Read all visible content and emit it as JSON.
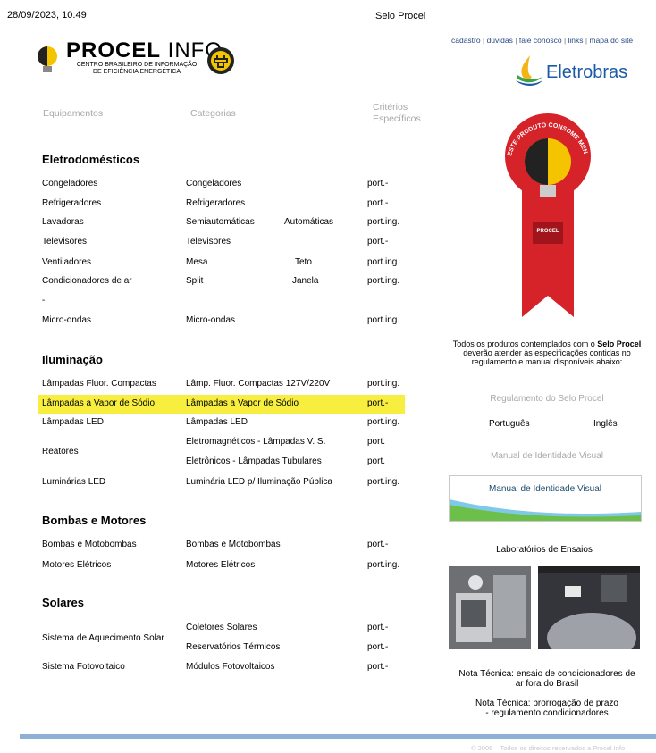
{
  "header": {
    "date": "28/09/2023, 10:49",
    "page_title": "Selo Procel"
  },
  "logo": {
    "name_bold": "PROCEL",
    "name_light": " INFO",
    "subtitle_line1": "CENTRO BRASILEIRO DE INFORMAÇÃO",
    "subtitle_line2": "DE EFICIÊNCIA ENERGÉTICA"
  },
  "top_links": [
    "cadastro",
    "dúvidas",
    "fale conosco",
    "links",
    "mapa do site"
  ],
  "eletrobras": "Eletrobras",
  "columns": {
    "equipamentos": "Equipamentos",
    "categorias": "Categorias",
    "criterios_1": "Critérios",
    "criterios_2": "Específicos"
  },
  "sections": {
    "eletrodomesticos": "Eletrodomésticos",
    "iluminacao": "Iluminação",
    "bombas": "Bombas e Motores",
    "solares": "Solares"
  },
  "rows": {
    "congeladores": {
      "equip": "Congeladores",
      "cat": "Congeladores",
      "crit": "port.-"
    },
    "refrigeradores": {
      "equip": "Refrigeradores",
      "cat": "Refrigeradores",
      "crit": "port.-"
    },
    "lavadoras": {
      "equip": "Lavadoras",
      "cat": "Semiautomáticas",
      "cat2": "Automáticas",
      "crit": "port.ing."
    },
    "televisores": {
      "equip": "Televisores",
      "cat": "Televisores",
      "crit": "port.-"
    },
    "ventiladores": {
      "equip": "Ventiladores",
      "cat": "Mesa",
      "cat2": "Teto",
      "crit": "port.ing."
    },
    "condicionadores": {
      "equip": "Condicionadores de ar",
      "cat": "Split",
      "cat2": "Janela",
      "crit": "port.ing."
    },
    "dash": "-",
    "microondas": {
      "equip": "Micro-ondas",
      "cat": "Micro-ondas",
      "crit": "port.ing."
    },
    "lfc": {
      "equip": "Lâmpadas Fluor. Compactas",
      "cat": "Lâmp. Fluor. Compactas 127V/220V",
      "crit": "port.ing."
    },
    "vapor": {
      "equip": "Lâmpadas a Vapor de Sódio",
      "cat": "Lâmpadas a Vapor de Sódio",
      "crit": "port.-"
    },
    "led": {
      "equip": "Lâmpadas LED",
      "cat": "Lâmpadas LED",
      "crit": "port.ing."
    },
    "reatores": {
      "equip": "Reatores",
      "cat": "Eletromagnéticos - Lâmpadas V. S.",
      "crit": "port.",
      "cat_b": "Eletrônicos - Lâmpadas Tubulares",
      "crit_b": "port."
    },
    "luminarias": {
      "equip": "Luminárias LED",
      "cat": "Luminária LED p/ Iluminação Pública",
      "crit": "port.ing."
    },
    "bombas": {
      "equip": "Bombas e Motobombas",
      "cat": "Bombas e Motobombas",
      "crit": "port.-"
    },
    "motores": {
      "equip": "Motores Elétricos",
      "cat": "Motores Elétricos",
      "crit": "port.ing."
    },
    "aquecimento": {
      "equip": "Sistema de Aquecimento Solar",
      "cat": "Coletores Solares",
      "crit": "port.-",
      "cat_b": "Reservatórios Térmicos",
      "crit_b": "port.-"
    },
    "fotovoltaico": {
      "equip": "Sistema Fotovoltaico",
      "cat": "Módulos Fotovoltaicos",
      "crit": "port.-"
    }
  },
  "ribbon": {
    "arc_text": "ESTE PRODUTO CONSOME MENOS ENERGIA",
    "badge": "PROCEL"
  },
  "right": {
    "intro_a": "Todos os produtos contemplados com o ",
    "intro_bold": "Selo Procel",
    "intro_b": " deverão atender às especificações contidas no regulamento e manual disponíveis abaixo:",
    "regulamento": "Regulamento do Selo Procel",
    "portugues": "Português",
    "ingles": "Inglês",
    "manual_label": "Manual de Identidade Visual",
    "manual_button": "Manual de Identidade Visual",
    "labs": "Laboratórios de Ensaios",
    "nota1_l1": "Nota Técnica: ensaio de condicionadores de",
    "nota1_l2": "ar fora do Brasil",
    "nota2_l1": "Nota Técnica: prorrogação de prazo",
    "nota2_l2": "- regulamento condicionadores"
  },
  "footer": {
    "copyright": "© 2006 – Todos os direitos reservados a Procel Info"
  },
  "colors": {
    "highlight": "#f7ee3f",
    "link": "#2a4a86",
    "ribbon": "#d6232a",
    "bar": "#8fb0d6"
  }
}
